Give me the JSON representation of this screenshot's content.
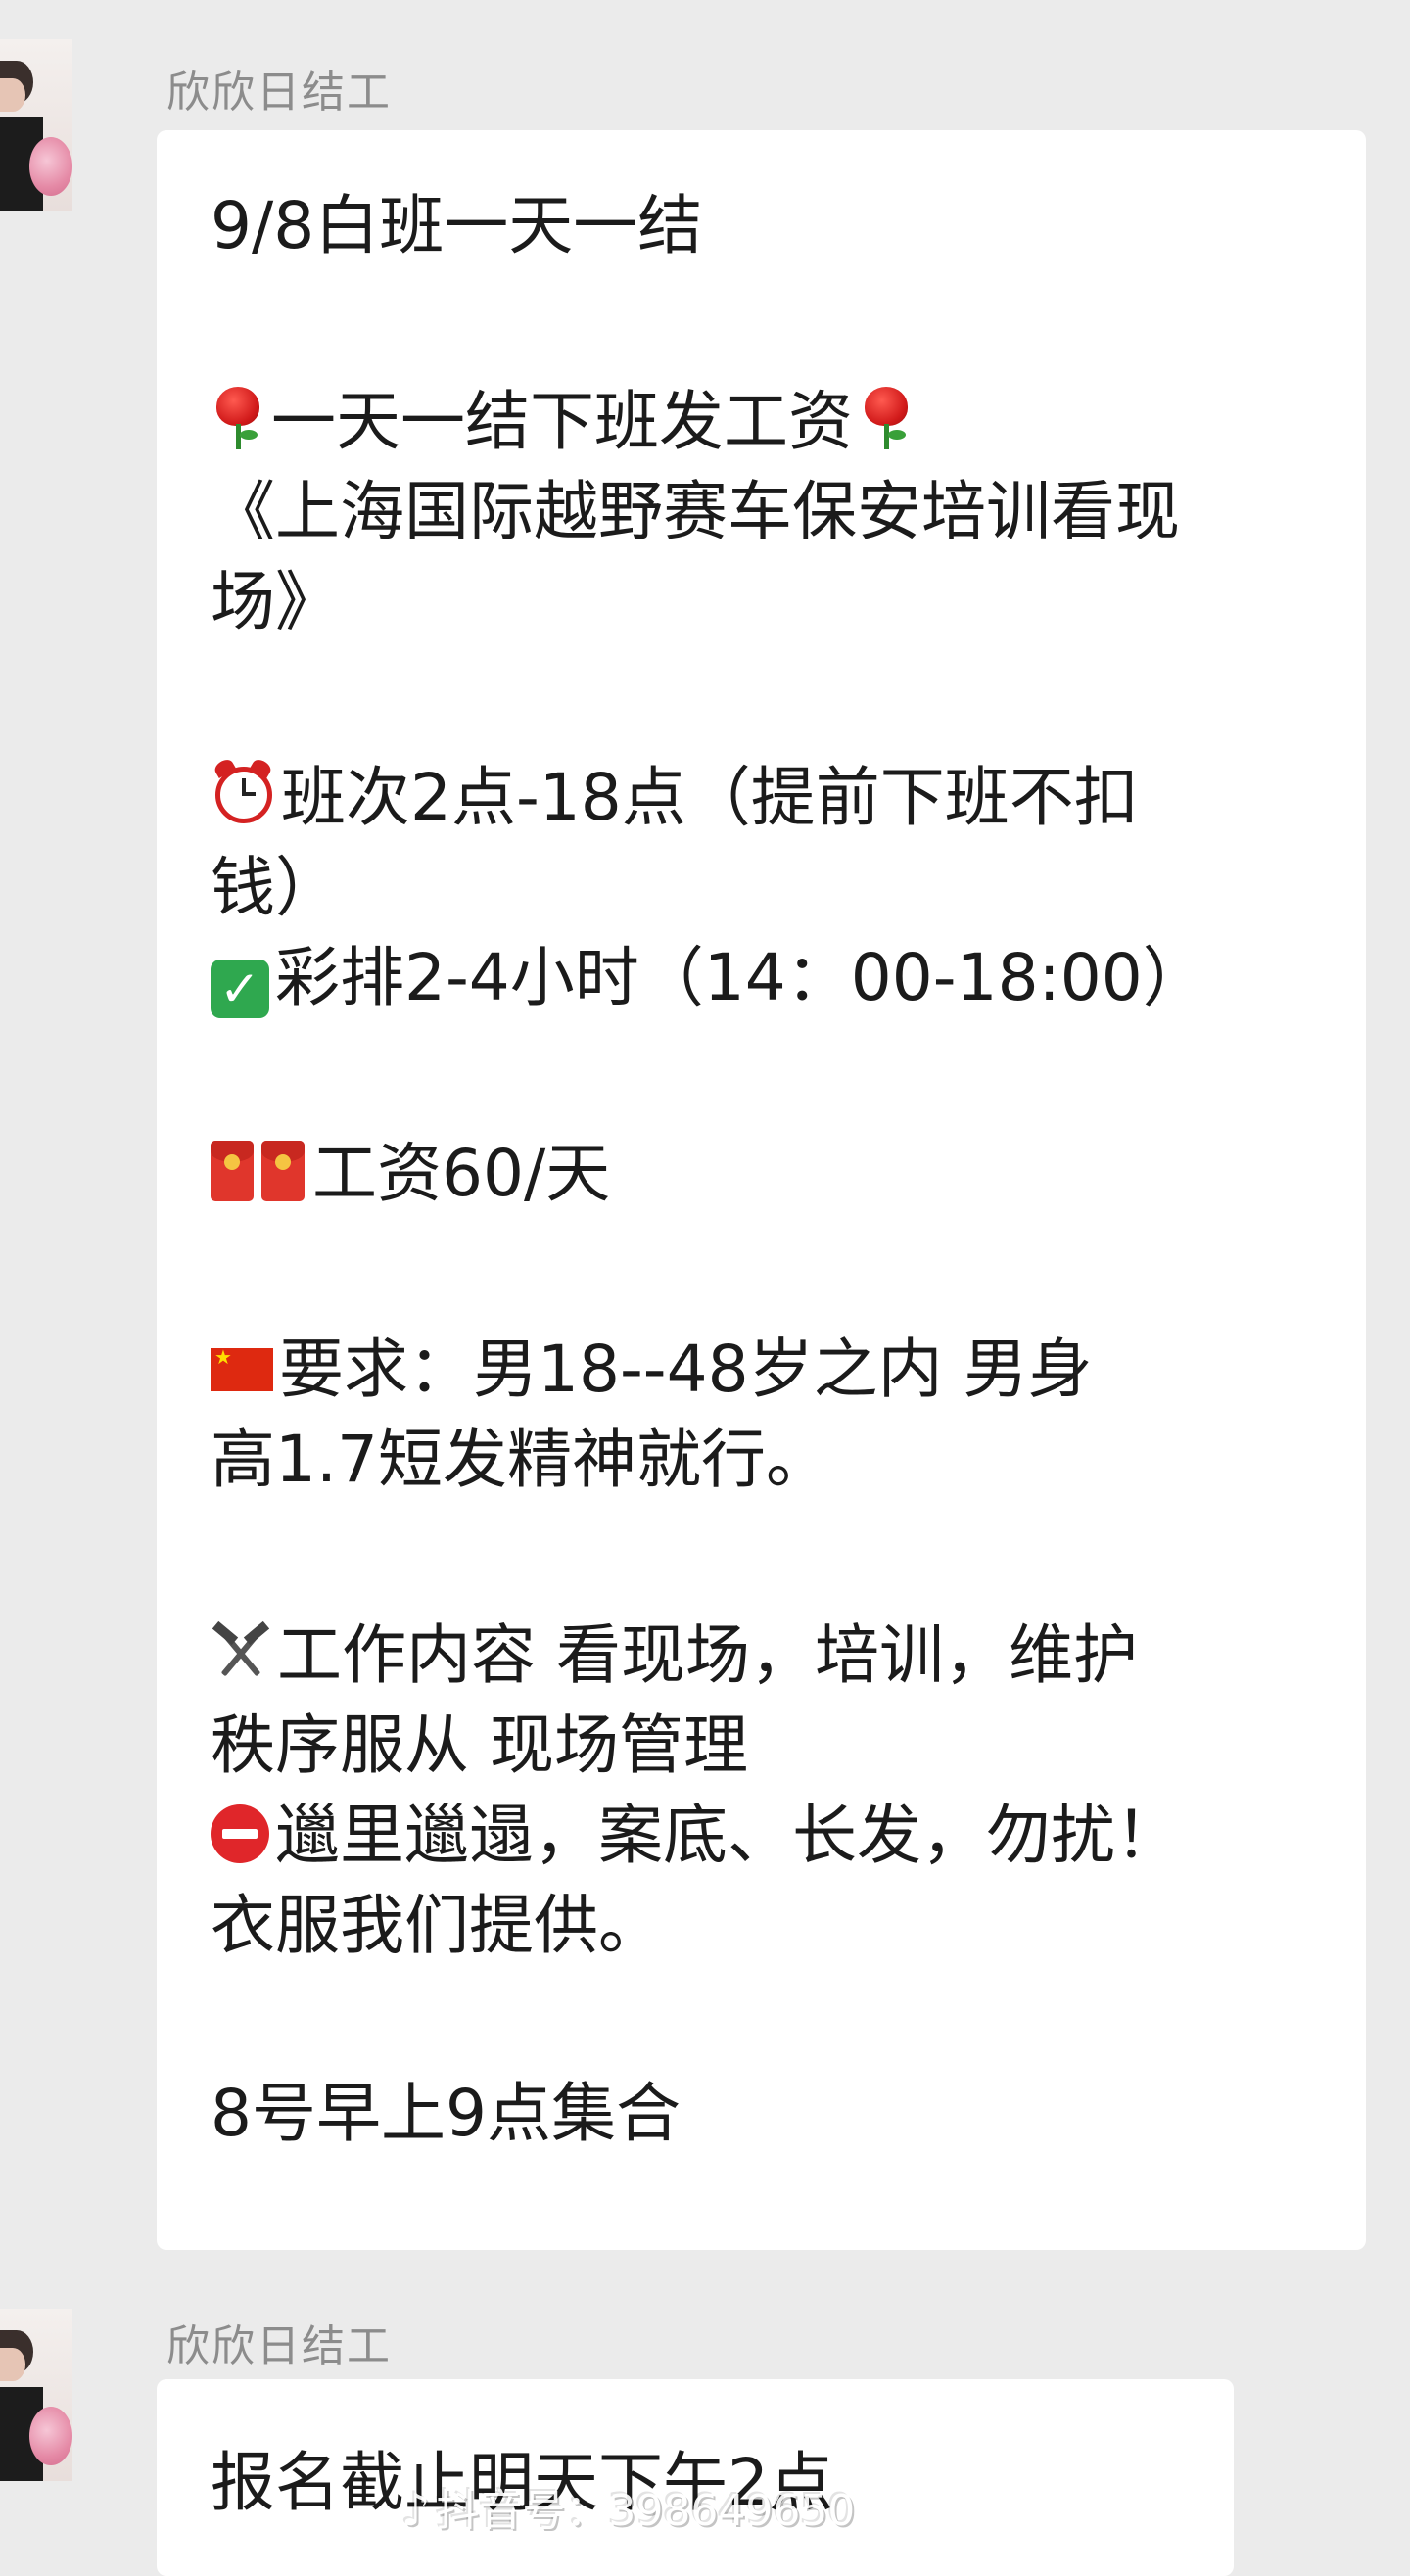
{
  "messages": [
    {
      "sender": "欣欣日结工",
      "lines": {
        "l1": "9/8白班一天一结",
        "l2": "一天一结下班发工资",
        "l3": "《上海国际越野赛车保安培训看现",
        "l4": "场》",
        "l5": "班次2点-18点（提前下班不扣",
        "l6": "钱）",
        "l7": "彩排2-4小时（14：00-18:00）",
        "l8": "工资60/天",
        "l9": "要求：男18--48岁之内  男身",
        "l10": "高1.7短发精神就行。",
        "l11": "工作内容  看现场，培训，维护",
        "l12": "秩序服从 现场管理",
        "l13": "邋里邋遢，案底、长发，勿扰！",
        "l14": "衣服我们提供。",
        "l15": "8号早上9点集合"
      }
    },
    {
      "sender": "欣欣日结工",
      "lines": {
        "l1": "报名截止明天下午2点"
      }
    }
  ],
  "watermark": {
    "text": "抖音号：398649650"
  },
  "icons": [
    "rose-icon",
    "alarm-clock-icon",
    "check-mark-icon",
    "red-envelope-icon",
    "china-flag-icon",
    "hammer-pick-icon",
    "no-entry-icon"
  ],
  "colors": {
    "background": "#ebebeb",
    "bubble": "#ffffff",
    "sender_text": "#8c8c8c"
  }
}
